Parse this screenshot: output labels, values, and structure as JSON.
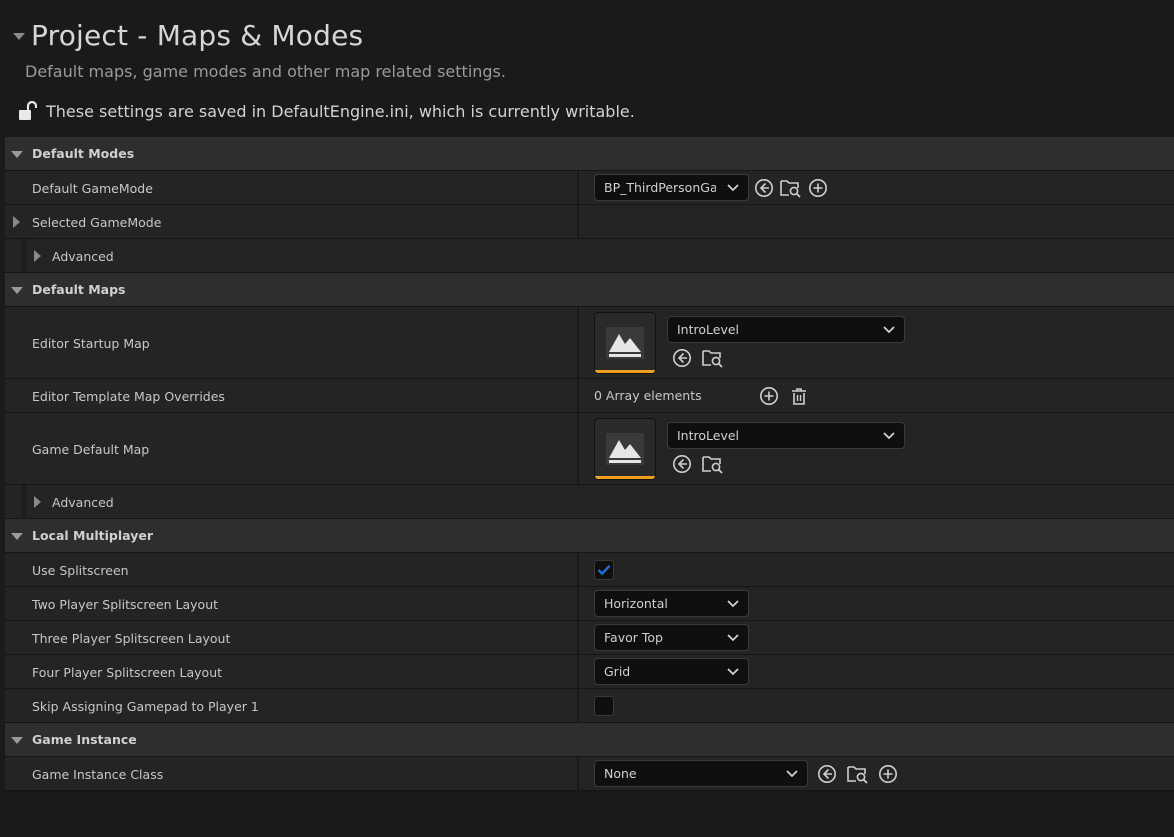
{
  "header": {
    "title": "Project - Maps & Modes",
    "subtitle": "Default maps, game modes and other map related settings.",
    "save_notice": "These settings are saved in DefaultEngine.ini, which is currently writable."
  },
  "categories": {
    "default_modes": "Default Modes",
    "default_maps": "Default Maps",
    "local_multiplayer": "Local Multiplayer",
    "game_instance": "Game Instance"
  },
  "default_modes": {
    "default_gamemode_label": "Default GameMode",
    "default_gamemode_value": "BP_ThirdPersonGameMode",
    "selected_gamemode_label": "Selected GameMode",
    "advanced_label": "Advanced"
  },
  "default_maps": {
    "editor_startup_label": "Editor Startup Map",
    "editor_startup_value": "IntroLevel",
    "template_overrides_label": "Editor Template Map Overrides",
    "template_overrides_value": "0 Array elements",
    "game_default_label": "Game Default Map",
    "game_default_value": "IntroLevel",
    "advanced_label": "Advanced"
  },
  "local_multiplayer": {
    "use_splitscreen_label": "Use Splitscreen",
    "use_splitscreen_checked": true,
    "two_player_label": "Two Player Splitscreen Layout",
    "two_player_value": "Horizontal",
    "three_player_label": "Three Player Splitscreen Layout",
    "three_player_value": "Favor Top",
    "four_player_label": "Four Player Splitscreen Layout",
    "four_player_value": "Grid",
    "skip_gamepad_label": "Skip Assigning Gamepad to Player 1",
    "skip_gamepad_checked": false
  },
  "game_instance": {
    "class_label": "Game Instance Class",
    "class_value": "None"
  },
  "colors": {
    "accent_check": "#1f6fd8",
    "asset_bar": "#f0a020"
  }
}
